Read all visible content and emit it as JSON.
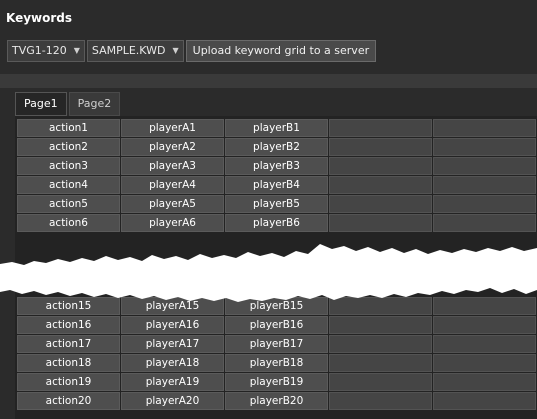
{
  "panel": {
    "title": "Keywords",
    "channel_select": "TVG1-120",
    "file_select": "SAMPLE.KWD",
    "upload_button": "Upload keyword grid to a server"
  },
  "tabs": [
    {
      "label": "Page1",
      "active": true
    },
    {
      "label": "Page2",
      "active": false
    }
  ],
  "grid_top": [
    [
      "action1",
      "playerA1",
      "playerB1",
      "",
      ""
    ],
    [
      "action2",
      "playerA2",
      "playerB2",
      "",
      ""
    ],
    [
      "action3",
      "playerA3",
      "playerB3",
      "",
      ""
    ],
    [
      "action4",
      "playerA4",
      "playerB4",
      "",
      ""
    ],
    [
      "action5",
      "playerA5",
      "playerB5",
      "",
      ""
    ],
    [
      "action6",
      "playerA6",
      "playerB6",
      "",
      ""
    ]
  ],
  "grid_bottom": [
    [
      "action15",
      "playerA15",
      "playerB15",
      "",
      ""
    ],
    [
      "action16",
      "playerA16",
      "playerB16",
      "",
      ""
    ],
    [
      "action17",
      "playerA17",
      "playerB17",
      "",
      ""
    ],
    [
      "action18",
      "playerA18",
      "playerB18",
      "",
      ""
    ],
    [
      "action19",
      "playerA19",
      "playerB19",
      "",
      ""
    ],
    [
      "action20",
      "playerA20",
      "playerB20",
      "",
      ""
    ]
  ],
  "colors": {
    "panel_bg": "#2b2b2b",
    "cell_bg": "#4e4e4e",
    "text": "#ffffff",
    "tear": "#ffffff"
  }
}
